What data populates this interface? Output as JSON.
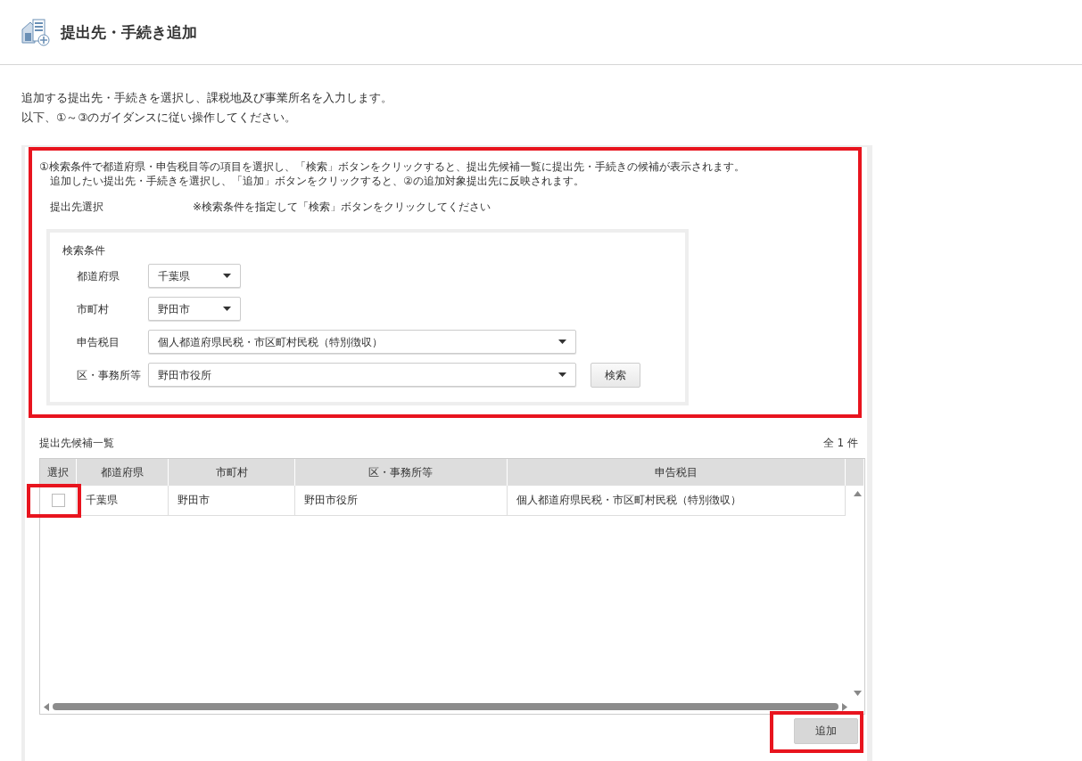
{
  "page": {
    "title": "提出先・手続き追加"
  },
  "intro": [
    "追加する提出先・手続きを選択し、課税地及び事業所名を入力します。",
    "以下、①～③のガイダンスに従い操作してください。"
  ],
  "guidance": {
    "highlighted": true,
    "lines": [
      "①検索条件で都道府県・申告税目等の項目を選択し、「検索」ボタンをクリックすると、提出先候補一覧に提出先・手続きの候補が表示されます。",
      "追加したい提出先・手続きを選択し、「追加」ボタンをクリックすると、②の追加対象提出先に反映されます。"
    ],
    "selection_label": "提出先選択",
    "selection_hint": "※検索条件を指定して「検索」ボタンをクリックしてください"
  },
  "search": {
    "title": "検索条件",
    "fields": [
      {
        "label": "都道府県",
        "value": "千葉県",
        "kind": "short"
      },
      {
        "label": "市町村",
        "value": "野田市",
        "kind": "short"
      },
      {
        "label": "申告税目",
        "value": "個人都道府県民税・市区町村民税（特別徴収）",
        "kind": "long"
      },
      {
        "label": "区・事務所等",
        "value": "野田市役所",
        "kind": "long"
      }
    ],
    "button": "検索"
  },
  "candidates": {
    "title": "提出先候補一覧",
    "count": "全 1 件",
    "select_header": "選択",
    "columns": [
      "都道府県",
      "市町村",
      "区・事務所等",
      "申告税目"
    ],
    "rows": [
      {
        "checked": false,
        "highlighted": true,
        "cells": [
          "千葉県",
          "野田市",
          "野田市役所",
          "個人都道府県民税・市区町村民税（特別徴収）"
        ]
      }
    ]
  },
  "add_button": {
    "label": "追加",
    "highlighted": true
  }
}
